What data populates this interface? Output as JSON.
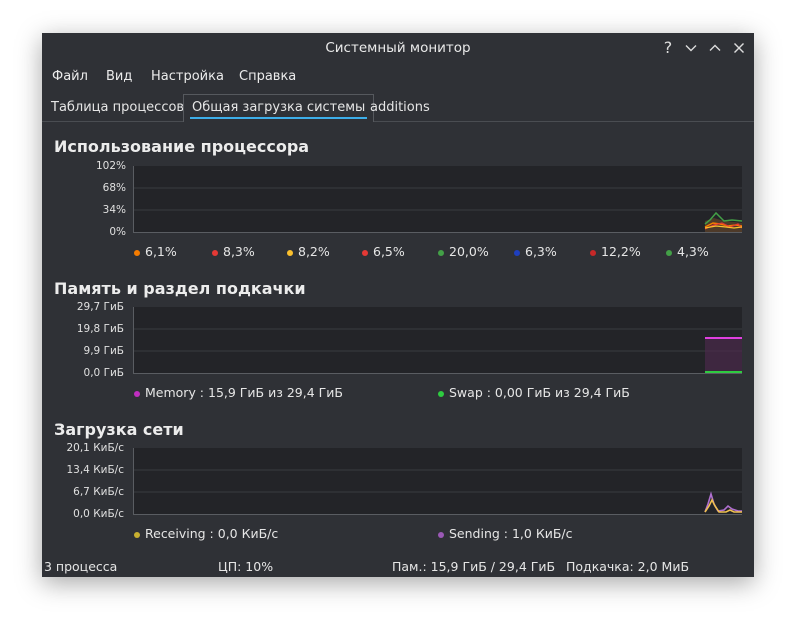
{
  "window": {
    "title": "Системный монитор"
  },
  "menu": [
    "Файл",
    "Вид",
    "Настройка",
    "Справка"
  ],
  "tabs": [
    "Таблица процессов",
    "Общая загрузка системы",
    "additions"
  ],
  "cpu": {
    "title": "Использование процессора",
    "ticks": [
      "102%",
      "68%",
      "34%",
      "0%"
    ],
    "legend": [
      {
        "label": "6,1%",
        "color": "#f57c00"
      },
      {
        "label": "8,3%",
        "color": "#e53935"
      },
      {
        "label": "8,2%",
        "color": "#fbc02d"
      },
      {
        "label": "6,5%",
        "color": "#e53935"
      },
      {
        "label": "20,0%",
        "color": "#43a047"
      },
      {
        "label": "6,3%",
        "color": "#1e3fbf"
      },
      {
        "label": "12,2%",
        "color": "#c62828"
      },
      {
        "label": "4,3%",
        "color": "#43a047"
      }
    ]
  },
  "memory": {
    "title": "Память и раздел подкачки",
    "ticks": [
      "29,7 ГиБ",
      "19,8 ГиБ",
      "9,9 ГиБ",
      "0,0 ГиБ"
    ],
    "legend": [
      {
        "label": "Memory : 15,9 ГиБ из 29,4 ГиБ",
        "color": "#c02ec0"
      },
      {
        "label": "Swap : 0,00 ГиБ из 29,4 ГиБ",
        "color": "#2ecc40"
      }
    ]
  },
  "network": {
    "title": "Загрузка сети",
    "ticks": [
      "20,1 КиБ/с",
      "13,4 КиБ/с",
      "6,7 КиБ/с",
      "0,0 КиБ/с"
    ],
    "legend": [
      {
        "label": "Receiving : 0,0 КиБ/с",
        "color": "#c8b030"
      },
      {
        "label": "Sending : 1,0 КиБ/с",
        "color": "#9b59b6"
      }
    ]
  },
  "status": {
    "processes": "3 процесса",
    "cpu": "ЦП: 10%",
    "memory": "Пам.: 15,9 ГиБ / 29,4 ГиБ",
    "swap": "Подкачка: 2,0 МиБ"
  }
}
